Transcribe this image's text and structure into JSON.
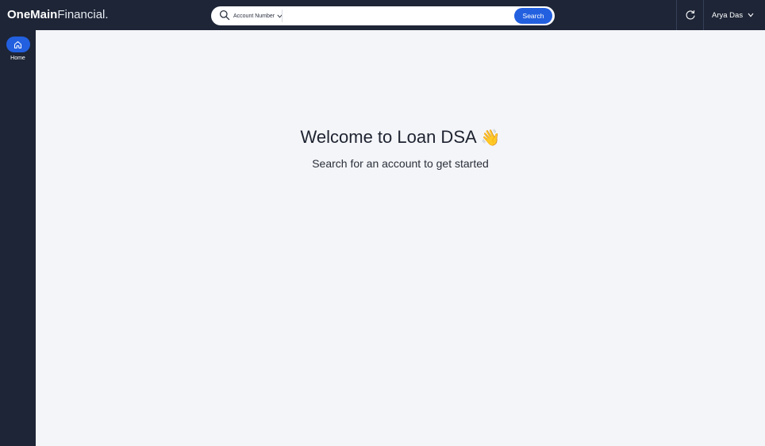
{
  "brand": {
    "name_bold": "OneMain",
    "name_light": "Financial",
    "dot": "."
  },
  "search": {
    "type_label": "Account Number",
    "placeholder": "",
    "value": "",
    "button_label": "Search"
  },
  "user": {
    "name": "Arya Das"
  },
  "sidebar": {
    "items": [
      {
        "label": "Home",
        "icon": "home-icon",
        "active": true
      }
    ]
  },
  "main": {
    "title": "Welcome to Loan DSA",
    "title_emoji": "👋",
    "subtitle": "Search for an account to get started"
  },
  "colors": {
    "nav_bg": "#1d2536",
    "accent": "#2360e0",
    "page_bg": "#f4f5f8"
  }
}
